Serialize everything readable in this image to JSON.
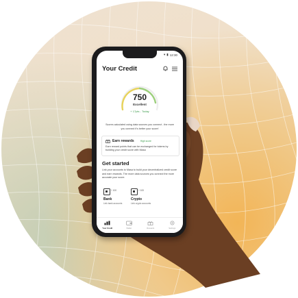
{
  "status_bar": {
    "time": "12:30"
  },
  "header": {
    "title": "Your Credit"
  },
  "score": {
    "value": "750",
    "rating": "Excellent",
    "change": "+ 17pts - Today"
  },
  "note": "Scores calculated using data sources you connect - the more you connect it's better your score!",
  "rewards_card": {
    "title": "Earn rewards",
    "badge": "High score",
    "body": "Earn reward points that can be exchanged for tokens by building your credit score with Masa"
  },
  "get_started": {
    "title": "Get started",
    "body": "Link your accounts to Masa to build your decentralized credit score and earn rewards. The more data sources you connect the more accurate your score.",
    "accounts": [
      {
        "points": "+ 100",
        "name": "Bank",
        "sub": "Link bank accounts"
      },
      {
        "points": "+ 100",
        "name": "Crypto",
        "sub": "Link crypto accounts"
      }
    ]
  },
  "tabs": [
    {
      "label": "Your Credit",
      "icon": "chart-icon",
      "active": true
    },
    {
      "label": "Wallet",
      "icon": "wallet-icon",
      "active": false
    },
    {
      "label": "Rewards",
      "icon": "gift-icon",
      "active": false
    },
    {
      "label": "Settings",
      "icon": "gear-icon",
      "active": false
    }
  ],
  "colors": {
    "accent_green": "#3a9a4a",
    "gauge_yellow": "#e8d35a",
    "text_dark": "#1c1c1c"
  }
}
